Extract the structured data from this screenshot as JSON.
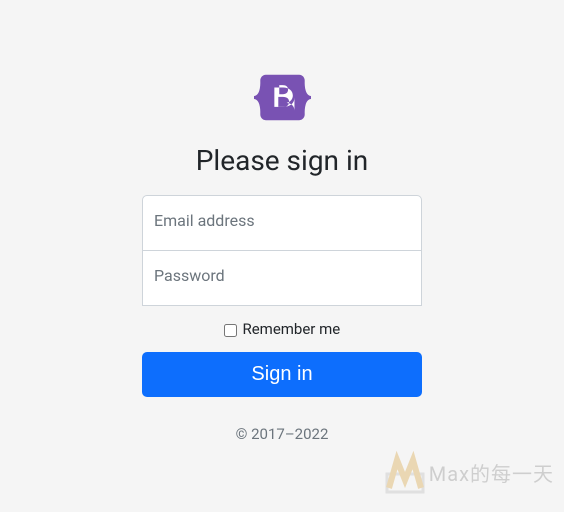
{
  "form": {
    "heading": "Please sign in",
    "email_label": "Email address",
    "password_label": "Password",
    "remember_label": " Remember me",
    "submit_label": "Sign in",
    "copyright": "© 2017–2022"
  },
  "watermark": {
    "text": "Max的每一天"
  }
}
